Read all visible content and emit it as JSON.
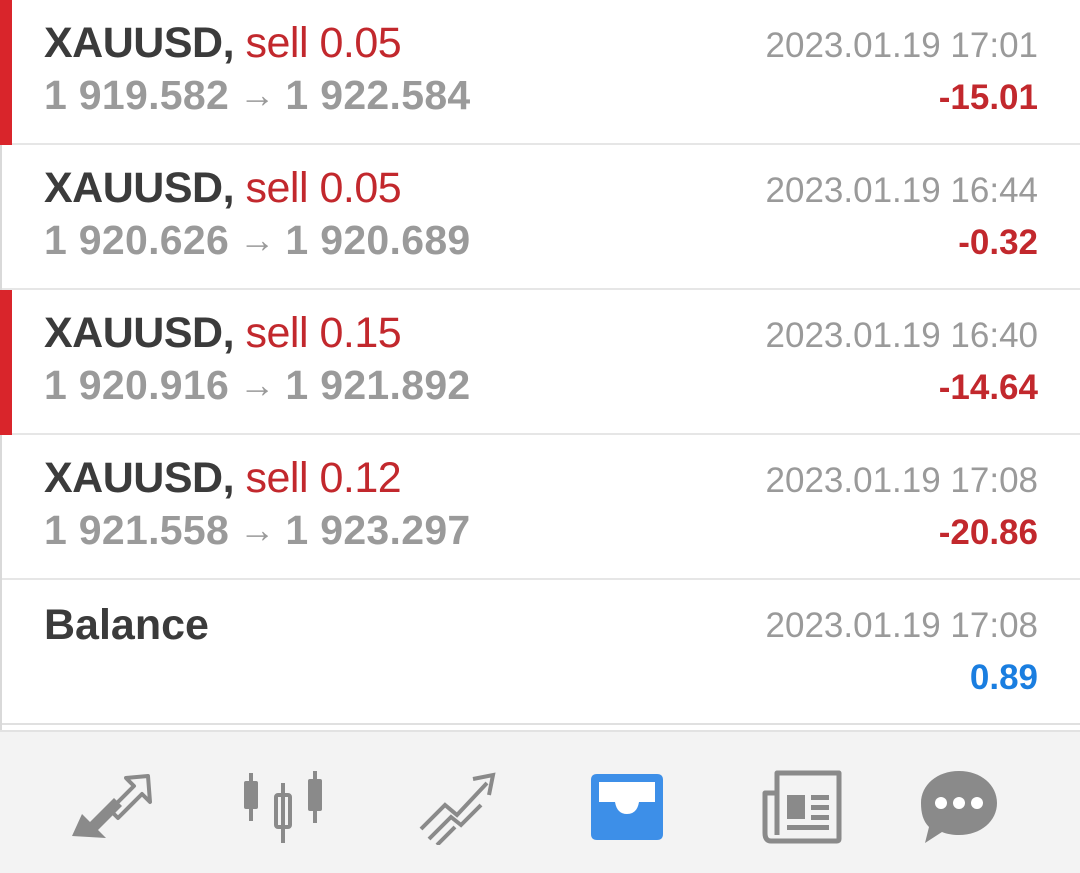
{
  "deals": [
    {
      "symbol": "XAUUSD",
      "comma": ",",
      "side": "sell",
      "volume": "0.05",
      "open_price": "1 919.582",
      "arrow": "→",
      "close_price": "1 922.584",
      "time": "2023.01.19 17:01",
      "profit": "-15.01",
      "marker": true
    },
    {
      "symbol": "XAUUSD",
      "comma": ",",
      "side": "sell",
      "volume": "0.05",
      "open_price": "1 920.626",
      "arrow": "→",
      "close_price": "1 920.689",
      "time": "2023.01.19 16:44",
      "profit": "-0.32",
      "marker": false
    },
    {
      "symbol": "XAUUSD",
      "comma": ",",
      "side": "sell",
      "volume": "0.15",
      "open_price": "1 920.916",
      "arrow": "→",
      "close_price": "1 921.892",
      "time": "2023.01.19 16:40",
      "profit": "-14.64",
      "marker": true
    },
    {
      "symbol": "XAUUSD",
      "comma": ",",
      "side": "sell",
      "volume": "0.12",
      "open_price": "1 921.558",
      "arrow": "→",
      "close_price": "1 923.297",
      "time": "2023.01.19 17:08",
      "profit": "-20.86",
      "marker": false
    }
  ],
  "balance": {
    "title": "Balance",
    "time": "2023.01.19 17:08",
    "amount": "0.89"
  },
  "colors": {
    "sell": "#c2282d",
    "profit_negative": "#c2282d",
    "profit_positive": "#1a7ee0",
    "marker": "#d9252b",
    "active_tab": "#3d8fe8",
    "inactive_tab": "#8a8a8a"
  },
  "tabbar": {
    "tabs": [
      {
        "icon": "quotes-arrows-icon",
        "active": false
      },
      {
        "icon": "candlestick-chart-icon",
        "active": false
      },
      {
        "icon": "trade-trend-icon",
        "active": false
      },
      {
        "icon": "history-inbox-icon",
        "active": true
      },
      {
        "icon": "news-icon",
        "active": false
      },
      {
        "icon": "chat-icon",
        "active": false
      }
    ]
  }
}
